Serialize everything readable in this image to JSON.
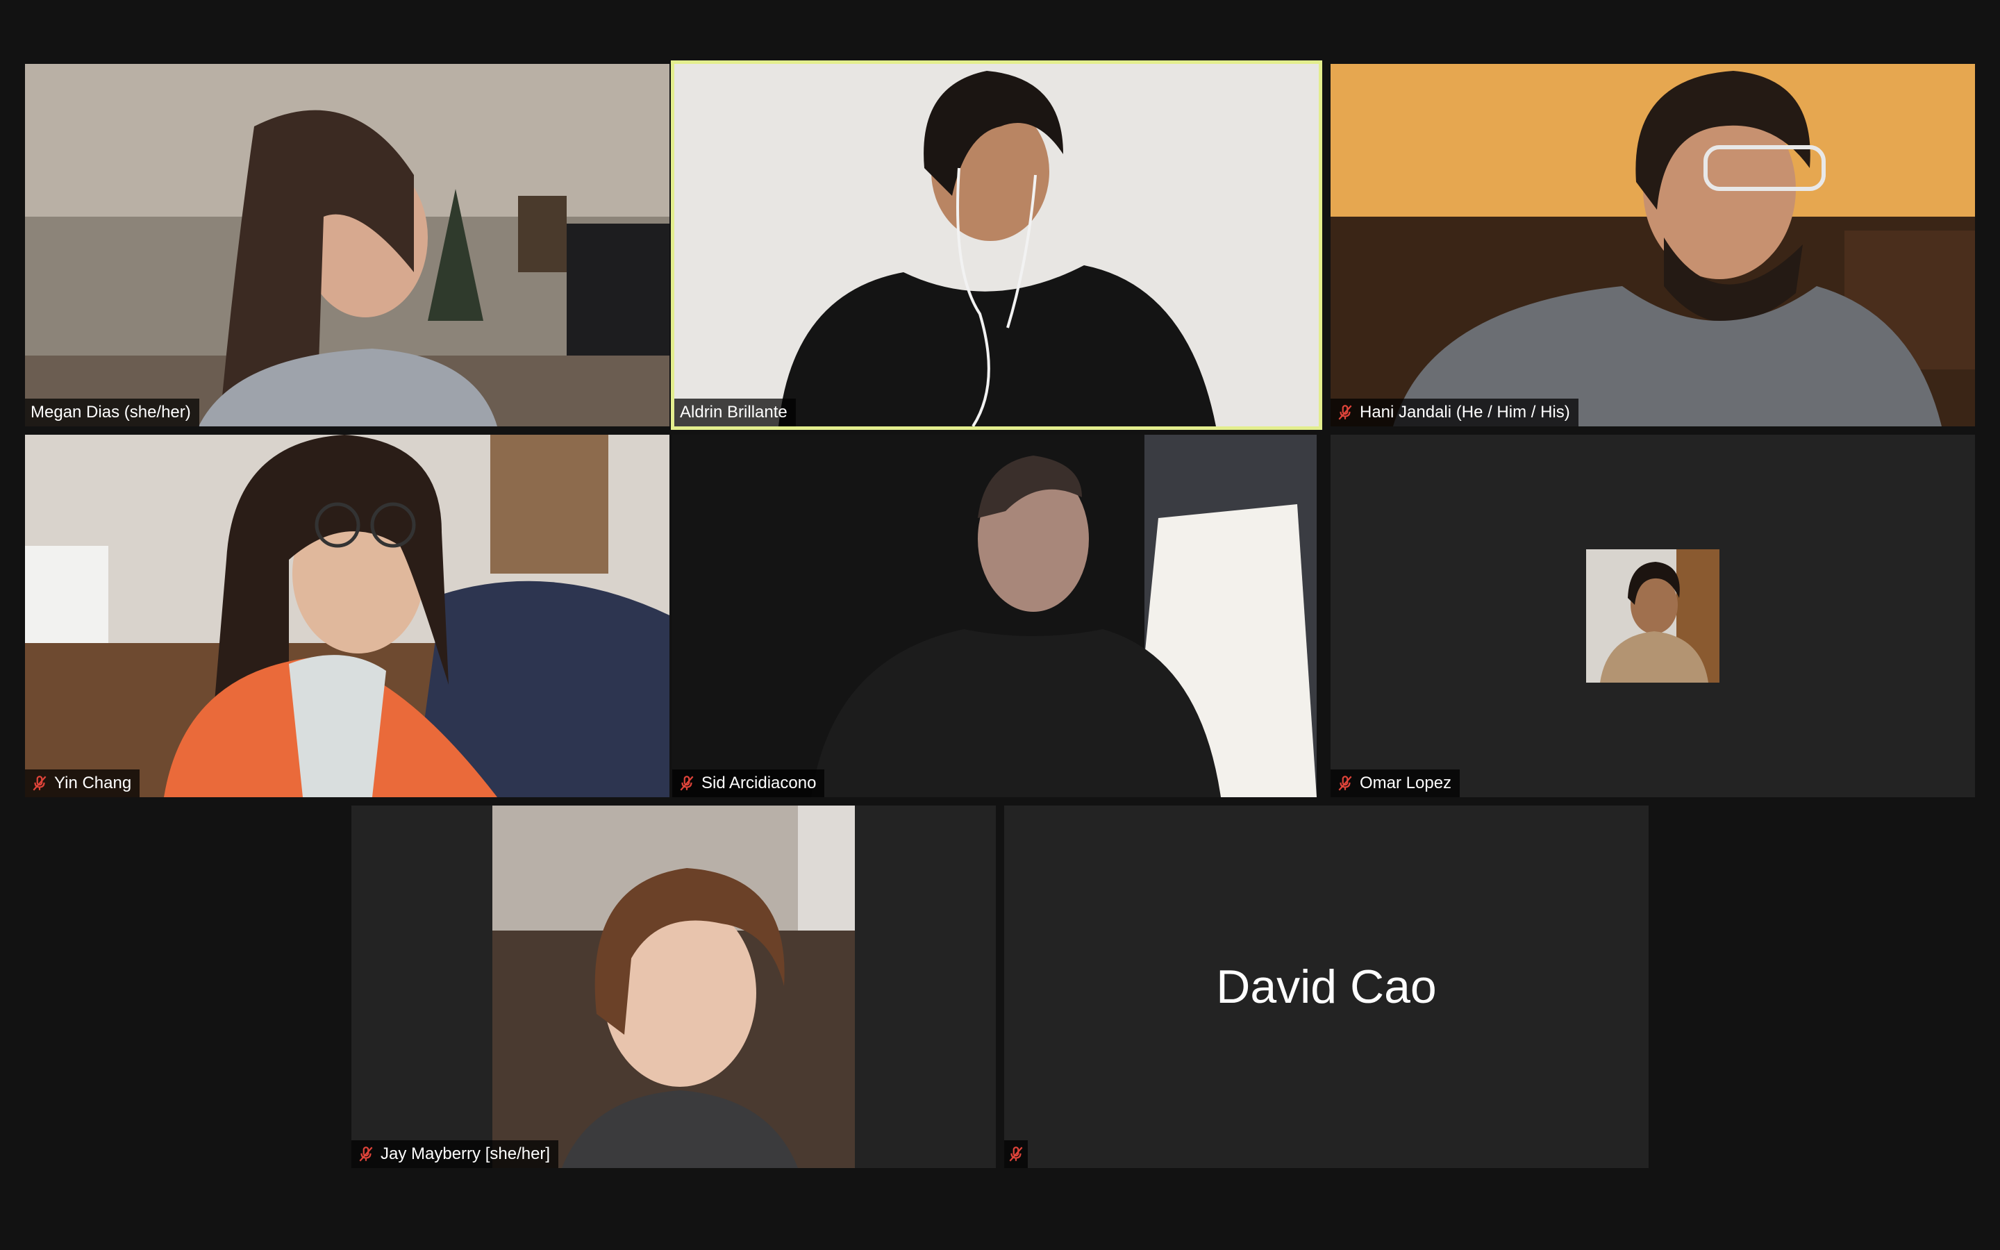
{
  "window": {
    "background": "#121212",
    "tile_background": "#232323",
    "active_speaker_border": "#e3ee8e"
  },
  "participants": [
    {
      "name": "Megan Dias (she/her)",
      "muted": false,
      "active": false,
      "video": "on"
    },
    {
      "name": "Aldrin Brillante",
      "muted": false,
      "active": true,
      "video": "on"
    },
    {
      "name": "Hani Jandali (He / Him / His)",
      "muted": true,
      "active": false,
      "video": "on"
    },
    {
      "name": "Yin Chang",
      "muted": true,
      "active": false,
      "video": "on"
    },
    {
      "name": "Sid Arcidiacono",
      "muted": true,
      "active": false,
      "video": "on"
    },
    {
      "name": "Omar Lopez",
      "muted": true,
      "active": false,
      "video": "profile-picture"
    },
    {
      "name": "Jay Mayberry [she/her]",
      "muted": true,
      "active": false,
      "video": "on"
    },
    {
      "name": "",
      "center_name": "David Cao",
      "muted": true,
      "active": false,
      "video": "off"
    }
  ],
  "icons": {
    "muted": "mic-muted-icon",
    "muted_color": "#e0443a"
  }
}
